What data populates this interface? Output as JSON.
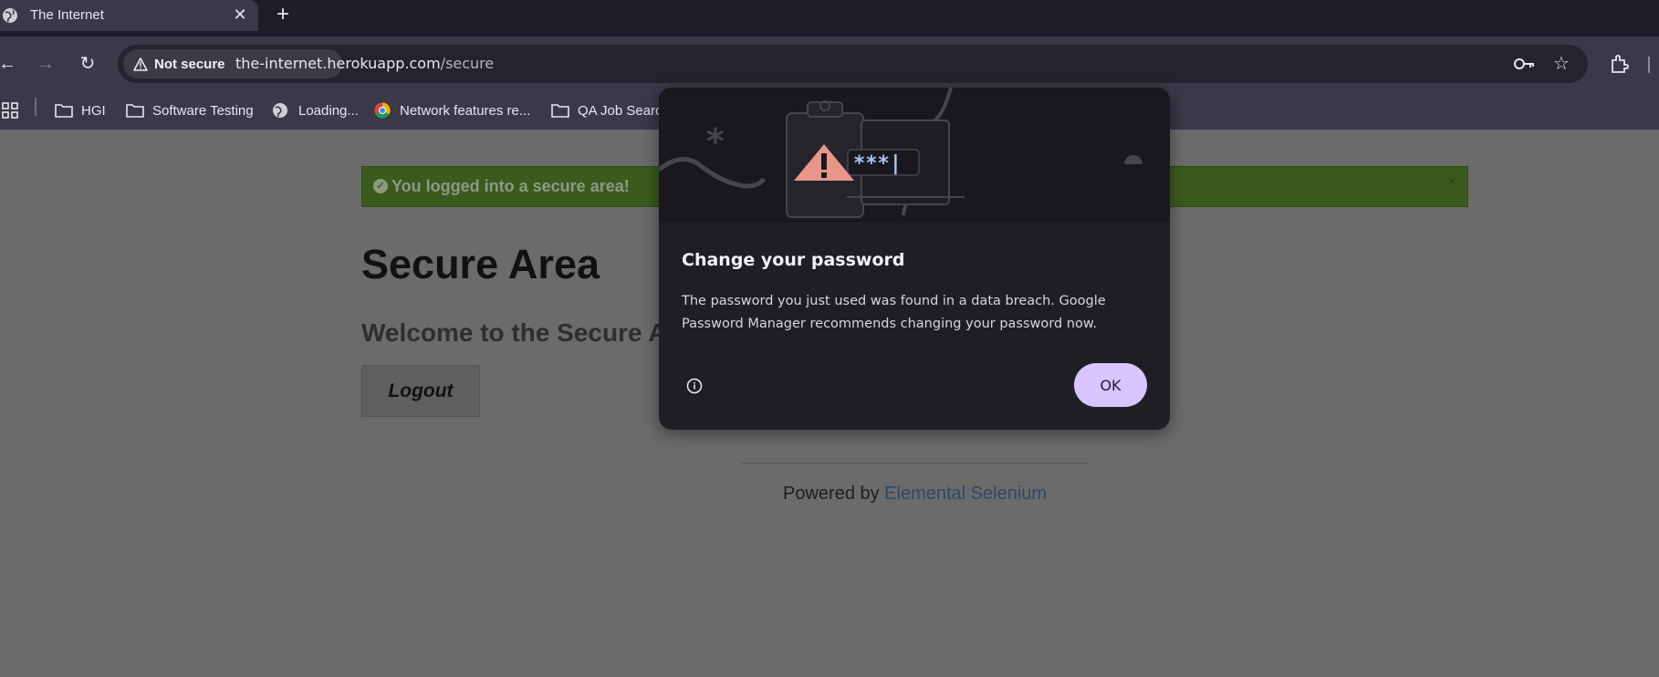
{
  "browser": {
    "tab": {
      "title": "The Internet"
    },
    "address_bar": {
      "security_label": "Not secure",
      "url_host": "the-internet.herokuapp.com",
      "url_path": "/secure"
    },
    "bookmarks": [
      {
        "label": "HGI",
        "icon": "folder-icon"
      },
      {
        "label": "Software Testing",
        "icon": "folder-icon"
      },
      {
        "label": "Loading...",
        "icon": "globe-icon"
      },
      {
        "label": "Network features re...",
        "icon": "chrome-icon"
      },
      {
        "label": "QA Job Searc",
        "icon": "folder-icon"
      }
    ]
  },
  "page": {
    "flash": {
      "message": "You logged into a secure area!",
      "close": "×"
    },
    "heading": "Secure Area",
    "subheading": "Welcome to the Secure A",
    "logout_label": "Logout",
    "footer": {
      "prefix": "Powered by ",
      "link": "Elemental Selenium"
    }
  },
  "dialog": {
    "title": "Change your password",
    "body": "The password you just used was found in a data breach. Google Password Manager recommends changing your password now.",
    "ok_label": "OK",
    "illustration_text": "***|"
  },
  "colors": {
    "accent": "#d8c5ff",
    "flash_bg": "#3b5b1e",
    "warning": "#e8968a",
    "dialog_bg": "#201e25"
  }
}
